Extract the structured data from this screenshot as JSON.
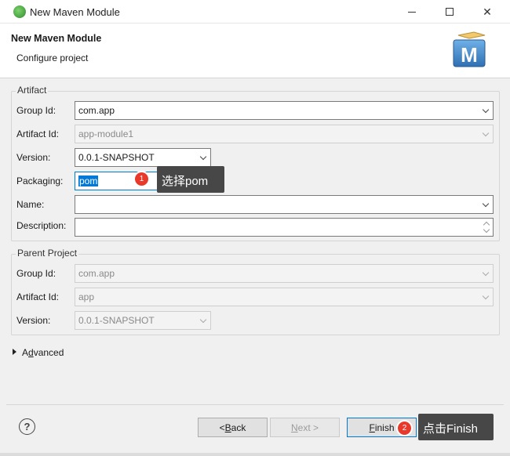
{
  "window": {
    "title": "New Maven Module",
    "controls": {
      "minimize": "—",
      "maximize": "☐",
      "close": "✕"
    }
  },
  "header": {
    "title": "New Maven Module",
    "subtitle": "Configure project",
    "logo_letter": "M"
  },
  "artifact": {
    "legend": "Artifact",
    "group_id": {
      "label": "Group Id:",
      "value": "com.app"
    },
    "artifact_id": {
      "label": "Artifact Id:",
      "value": "app-module1"
    },
    "version": {
      "label": "Version:",
      "value": "0.0.1-SNAPSHOT"
    },
    "packaging": {
      "label": "Packaging:",
      "value": "pom"
    },
    "name": {
      "label": "Name:",
      "value": ""
    },
    "description": {
      "label": "Description:",
      "value": ""
    }
  },
  "parent": {
    "legend": "Parent Project",
    "group_id": {
      "label": "Group Id:",
      "value": "com.app"
    },
    "artifact_id": {
      "label": "Artifact Id:",
      "value": "app"
    },
    "version": {
      "label": "Version:",
      "value": "0.0.1-SNAPSHOT"
    }
  },
  "advanced": {
    "label_prefix": "A",
    "label_mnemonic": "d",
    "label_rest": "vanced"
  },
  "annotations": {
    "step1": {
      "number": "1",
      "text": "选择pom"
    },
    "step2": {
      "number": "2",
      "text": "点击Finish"
    }
  },
  "buttons": {
    "help": "?",
    "back": {
      "prefix": "< ",
      "mnemonic": "B",
      "rest": "ack"
    },
    "next": {
      "mnemonic": "N",
      "rest": "ext >"
    },
    "finish": {
      "mnemonic": "F",
      "rest": "inish"
    }
  },
  "colors": {
    "accent": "#0078d7",
    "badge": "#e8392b",
    "callout_bg": "#474747"
  }
}
